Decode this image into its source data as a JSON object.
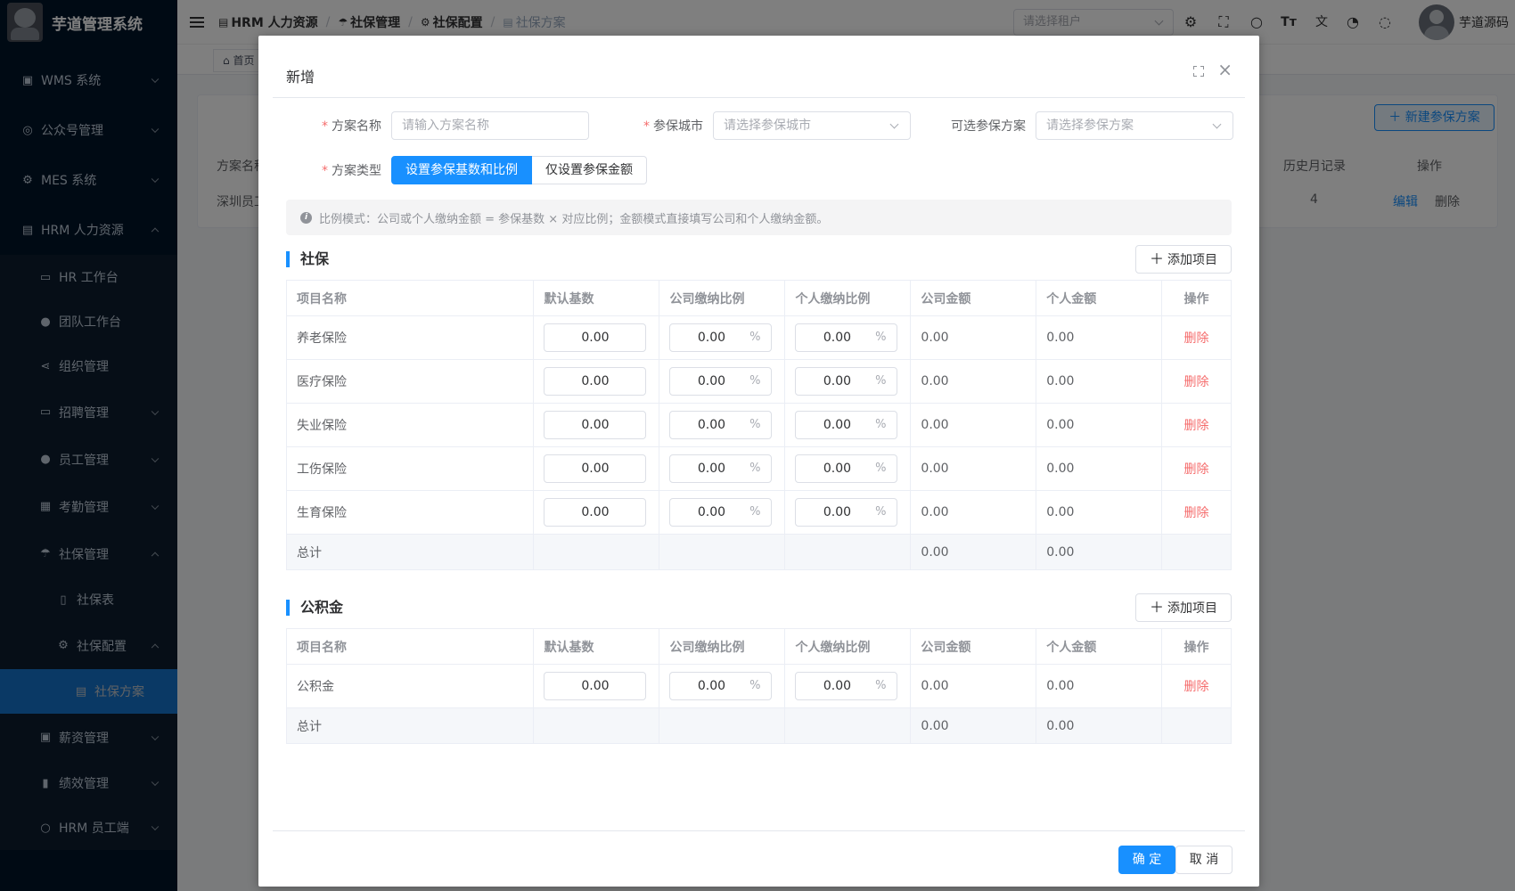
{
  "app": {
    "title": "芋道管理系统"
  },
  "sidebar": {
    "items": [
      {
        "label": "WMS 系统",
        "icon": "box-icon",
        "glyph": "▣"
      },
      {
        "label": "公众号管理",
        "icon": "compass-icon",
        "glyph": "◎"
      },
      {
        "label": "MES 系统",
        "icon": "gear-icon",
        "glyph": "⚙"
      },
      {
        "label": "HRM 人力资源",
        "icon": "building-icon",
        "glyph": "▤"
      },
      {
        "label": "HR 工作台",
        "icon": "monitor-icon",
        "glyph": "▭"
      },
      {
        "label": "团队工作台",
        "icon": "user-icon",
        "glyph": "●"
      },
      {
        "label": "组织管理",
        "icon": "share-icon",
        "glyph": "⋖"
      },
      {
        "label": "招聘管理",
        "icon": "briefcase-icon",
        "glyph": "▭"
      },
      {
        "label": "员工管理",
        "icon": "user-icon",
        "glyph": "●"
      },
      {
        "label": "考勤管理",
        "icon": "calendar-icon",
        "glyph": "▦"
      },
      {
        "label": "社保管理",
        "icon": "umbrella-icon",
        "glyph": "☂"
      },
      {
        "label": "社保表",
        "icon": "document-icon",
        "glyph": "▯"
      },
      {
        "label": "社保配置",
        "icon": "gear-icon",
        "glyph": "⚙"
      },
      {
        "label": "社保方案",
        "icon": "document-icon",
        "glyph": "▤"
      },
      {
        "label": "薪资管理",
        "icon": "wallet-icon",
        "glyph": "▣"
      },
      {
        "label": "绩效管理",
        "icon": "bar-chart-icon",
        "glyph": "▮"
      },
      {
        "label": "HRM 员工端",
        "icon": "user-icon",
        "glyph": "○"
      }
    ]
  },
  "header": {
    "breadcrumb": [
      "HRM 人力资源",
      "社保管理",
      "社保配置",
      "社保方案"
    ],
    "tenant_placeholder": "请选择租户",
    "user_name": "芋道源码"
  },
  "tags": {
    "home": "首页"
  },
  "page": {
    "new_button": "新建参保方案",
    "columns": {
      "name": "方案名称",
      "history": "历史月记录",
      "ops": "操作"
    },
    "row": {
      "name": "深圳员工",
      "history": "4",
      "edit": "编辑",
      "delete": "删除"
    }
  },
  "dialog": {
    "title": "新增",
    "form": {
      "plan_name_label": "方案名称",
      "plan_name_placeholder": "请输入方案名称",
      "city_label": "参保城市",
      "city_placeholder": "请选择参保城市",
      "optional_label": "可选参保方案",
      "optional_placeholder": "请选择参保方案",
      "type_label": "方案类型",
      "type_option_ratio": "设置参保基数和比例",
      "type_option_amount": "仅设置参保金额"
    },
    "alert": "比例模式：公司或个人缴纳金额 = 参保基数 × 对应比例；金额模式直接填写公司和个人缴纳金额。",
    "columns": [
      "项目名称",
      "默认基数",
      "公司缴纳比例",
      "个人缴纳比例",
      "公司金额",
      "个人金额",
      "操作"
    ],
    "add_item": "添加项目",
    "delete": "删除",
    "total_label": "总计",
    "pct_unit": "%",
    "social": {
      "title": "社保",
      "rows": [
        {
          "name": "养老保险",
          "base": "0.00",
          "company_ratio": "0.00",
          "personal_ratio": "0.00",
          "company_amount": "0.00",
          "personal_amount": "0.00"
        },
        {
          "name": "医疗保险",
          "base": "0.00",
          "company_ratio": "0.00",
          "personal_ratio": "0.00",
          "company_amount": "0.00",
          "personal_amount": "0.00"
        },
        {
          "name": "失业保险",
          "base": "0.00",
          "company_ratio": "0.00",
          "personal_ratio": "0.00",
          "company_amount": "0.00",
          "personal_amount": "0.00"
        },
        {
          "name": "工伤保险",
          "base": "0.00",
          "company_ratio": "0.00",
          "personal_ratio": "0.00",
          "company_amount": "0.00",
          "personal_amount": "0.00"
        },
        {
          "name": "生育保险",
          "base": "0.00",
          "company_ratio": "0.00",
          "personal_ratio": "0.00",
          "company_amount": "0.00",
          "personal_amount": "0.00"
        }
      ],
      "total": {
        "company_amount": "0.00",
        "personal_amount": "0.00"
      }
    },
    "fund": {
      "title": "公积金",
      "rows": [
        {
          "name": "公积金",
          "base": "0.00",
          "company_ratio": "0.00",
          "personal_ratio": "0.00",
          "company_amount": "0.00",
          "personal_amount": "0.00"
        }
      ],
      "total": {
        "company_amount": "0.00",
        "personal_amount": "0.00"
      }
    },
    "ok": "确 定",
    "cancel": "取 消"
  },
  "colors": {
    "primary": "#1890ff",
    "danger": "#f56c6c",
    "sidebar_bg": "#001529"
  }
}
